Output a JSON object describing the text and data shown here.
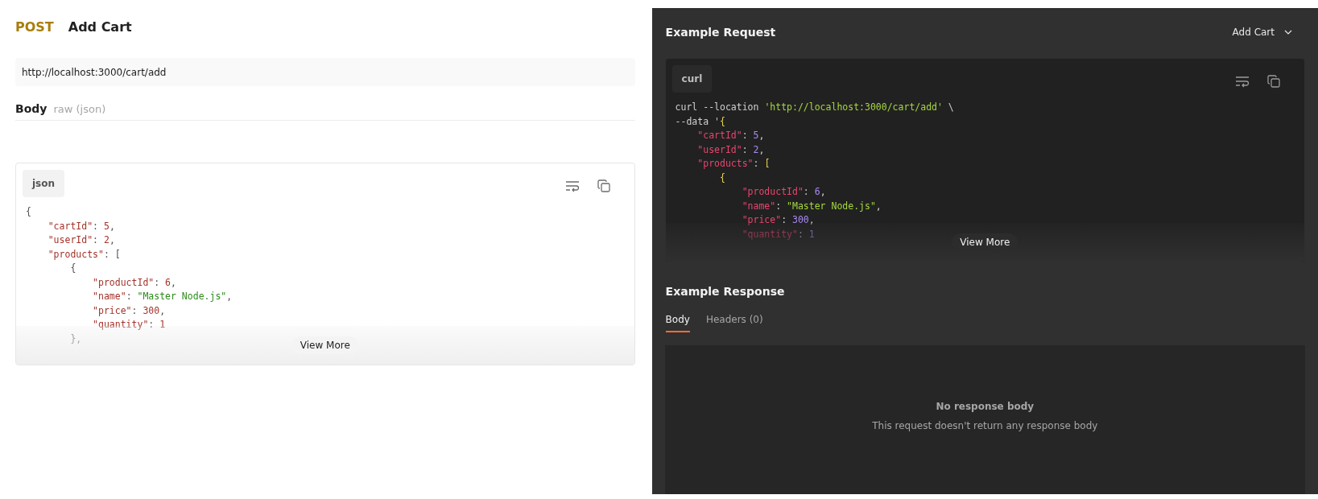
{
  "request": {
    "method": "POST",
    "name": "Add Cart",
    "url": "http://localhost:3000/cart/add",
    "body_label": "Body",
    "body_type": "raw (json)",
    "code_block": {
      "language": "json",
      "button": "View More",
      "lines": [
        [
          {
            "kind": "bracket",
            "text": "{"
          }
        ],
        [
          {
            "kind": "key",
            "text": "    \"cartId\""
          },
          {
            "kind": "punct",
            "text": ": "
          },
          {
            "kind": "num",
            "text": "5"
          },
          {
            "kind": "punct",
            "text": ","
          }
        ],
        [
          {
            "kind": "key",
            "text": "    \"userId\""
          },
          {
            "kind": "punct",
            "text": ": "
          },
          {
            "kind": "num",
            "text": "2"
          },
          {
            "kind": "punct",
            "text": ","
          }
        ],
        [
          {
            "kind": "key",
            "text": "    \"products\""
          },
          {
            "kind": "punct",
            "text": ": "
          },
          {
            "kind": "bracket",
            "text": "["
          }
        ],
        [
          {
            "kind": "bracket",
            "text": "        {"
          }
        ],
        [
          {
            "kind": "key",
            "text": "            \"productId\""
          },
          {
            "kind": "punct",
            "text": ": "
          },
          {
            "kind": "num",
            "text": "6"
          },
          {
            "kind": "punct",
            "text": ","
          }
        ],
        [
          {
            "kind": "key",
            "text": "            \"name\""
          },
          {
            "kind": "punct",
            "text": ": "
          },
          {
            "kind": "str",
            "text": "\"Master Node.js\""
          },
          {
            "kind": "punct",
            "text": ","
          }
        ],
        [
          {
            "kind": "key",
            "text": "            \"price\""
          },
          {
            "kind": "punct",
            "text": ": "
          },
          {
            "kind": "num",
            "text": "300"
          },
          {
            "kind": "punct",
            "text": ","
          }
        ],
        [
          {
            "kind": "key",
            "text": "            \"quantity\""
          },
          {
            "kind": "punct",
            "text": ": "
          },
          {
            "kind": "num",
            "text": "1"
          }
        ],
        [
          {
            "kind": "bracket",
            "text": "        },"
          }
        ]
      ]
    }
  },
  "example_request": {
    "title": "Example Request",
    "selector": "Add Cart",
    "code_block": {
      "language": "curl",
      "button": "View More",
      "lines": [
        [
          {
            "kind": "plain",
            "text": "curl --location "
          },
          {
            "kind": "str",
            "text": "'http://localhost:3000/cart/add'"
          },
          {
            "kind": "plain",
            "text": " \\"
          }
        ],
        [
          {
            "kind": "plain",
            "text": "--data '"
          },
          {
            "kind": "bracket",
            "text": "{"
          }
        ],
        [
          {
            "kind": "key",
            "text": "    \"cartId\""
          },
          {
            "kind": "punct",
            "text": ": "
          },
          {
            "kind": "num",
            "text": "5"
          },
          {
            "kind": "punct",
            "text": ","
          }
        ],
        [
          {
            "kind": "key",
            "text": "    \"userId\""
          },
          {
            "kind": "punct",
            "text": ": "
          },
          {
            "kind": "num",
            "text": "2"
          },
          {
            "kind": "punct",
            "text": ","
          }
        ],
        [
          {
            "kind": "key",
            "text": "    \"products\""
          },
          {
            "kind": "punct",
            "text": ": "
          },
          {
            "kind": "bracket",
            "text": "["
          }
        ],
        [
          {
            "kind": "bracket",
            "text": "        {"
          }
        ],
        [
          {
            "kind": "key",
            "text": "            \"productId\""
          },
          {
            "kind": "punct",
            "text": ": "
          },
          {
            "kind": "num",
            "text": "6"
          },
          {
            "kind": "punct",
            "text": ","
          }
        ],
        [
          {
            "kind": "key",
            "text": "            \"name\""
          },
          {
            "kind": "punct",
            "text": ": "
          },
          {
            "kind": "str",
            "text": "\"Master Node.js\""
          },
          {
            "kind": "punct",
            "text": ","
          }
        ],
        [
          {
            "kind": "key",
            "text": "            \"price\""
          },
          {
            "kind": "punct",
            "text": ": "
          },
          {
            "kind": "num",
            "text": "300"
          },
          {
            "kind": "punct",
            "text": ","
          }
        ],
        [
          {
            "kind": "key",
            "text": "            \"quantity\""
          },
          {
            "kind": "punct",
            "text": ": "
          },
          {
            "kind": "num",
            "text": "1"
          }
        ]
      ]
    }
  },
  "example_response": {
    "title": "Example Response",
    "tabs": [
      {
        "label": "Body",
        "selected": true
      },
      {
        "label": "Headers (0)",
        "selected": false
      }
    ],
    "empty_title": "No response body",
    "empty_text": "This request doesn't return any response body"
  }
}
